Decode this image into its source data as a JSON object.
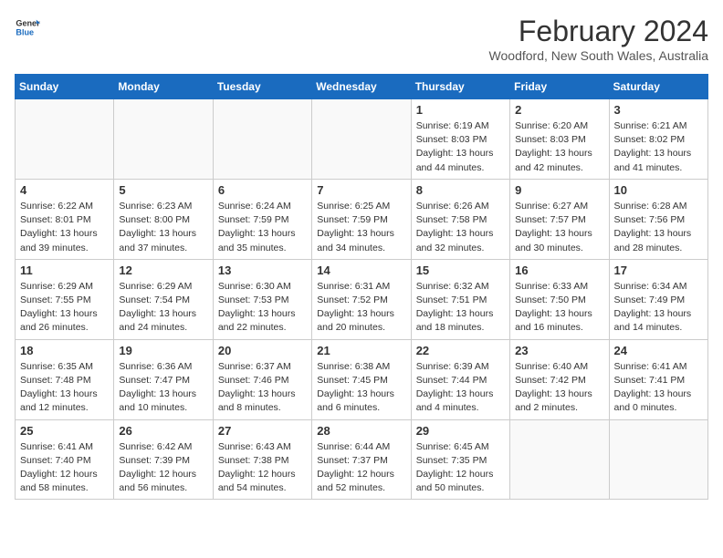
{
  "header": {
    "logo_text_general": "General",
    "logo_text_blue": "Blue",
    "month_year": "February 2024",
    "location": "Woodford, New South Wales, Australia"
  },
  "weekdays": [
    "Sunday",
    "Monday",
    "Tuesday",
    "Wednesday",
    "Thursday",
    "Friday",
    "Saturday"
  ],
  "weeks": [
    [
      {
        "day": "",
        "info": ""
      },
      {
        "day": "",
        "info": ""
      },
      {
        "day": "",
        "info": ""
      },
      {
        "day": "",
        "info": ""
      },
      {
        "day": "1",
        "info": "Sunrise: 6:19 AM\nSunset: 8:03 PM\nDaylight: 13 hours\nand 44 minutes."
      },
      {
        "day": "2",
        "info": "Sunrise: 6:20 AM\nSunset: 8:03 PM\nDaylight: 13 hours\nand 42 minutes."
      },
      {
        "day": "3",
        "info": "Sunrise: 6:21 AM\nSunset: 8:02 PM\nDaylight: 13 hours\nand 41 minutes."
      }
    ],
    [
      {
        "day": "4",
        "info": "Sunrise: 6:22 AM\nSunset: 8:01 PM\nDaylight: 13 hours\nand 39 minutes."
      },
      {
        "day": "5",
        "info": "Sunrise: 6:23 AM\nSunset: 8:00 PM\nDaylight: 13 hours\nand 37 minutes."
      },
      {
        "day": "6",
        "info": "Sunrise: 6:24 AM\nSunset: 7:59 PM\nDaylight: 13 hours\nand 35 minutes."
      },
      {
        "day": "7",
        "info": "Sunrise: 6:25 AM\nSunset: 7:59 PM\nDaylight: 13 hours\nand 34 minutes."
      },
      {
        "day": "8",
        "info": "Sunrise: 6:26 AM\nSunset: 7:58 PM\nDaylight: 13 hours\nand 32 minutes."
      },
      {
        "day": "9",
        "info": "Sunrise: 6:27 AM\nSunset: 7:57 PM\nDaylight: 13 hours\nand 30 minutes."
      },
      {
        "day": "10",
        "info": "Sunrise: 6:28 AM\nSunset: 7:56 PM\nDaylight: 13 hours\nand 28 minutes."
      }
    ],
    [
      {
        "day": "11",
        "info": "Sunrise: 6:29 AM\nSunset: 7:55 PM\nDaylight: 13 hours\nand 26 minutes."
      },
      {
        "day": "12",
        "info": "Sunrise: 6:29 AM\nSunset: 7:54 PM\nDaylight: 13 hours\nand 24 minutes."
      },
      {
        "day": "13",
        "info": "Sunrise: 6:30 AM\nSunset: 7:53 PM\nDaylight: 13 hours\nand 22 minutes."
      },
      {
        "day": "14",
        "info": "Sunrise: 6:31 AM\nSunset: 7:52 PM\nDaylight: 13 hours\nand 20 minutes."
      },
      {
        "day": "15",
        "info": "Sunrise: 6:32 AM\nSunset: 7:51 PM\nDaylight: 13 hours\nand 18 minutes."
      },
      {
        "day": "16",
        "info": "Sunrise: 6:33 AM\nSunset: 7:50 PM\nDaylight: 13 hours\nand 16 minutes."
      },
      {
        "day": "17",
        "info": "Sunrise: 6:34 AM\nSunset: 7:49 PM\nDaylight: 13 hours\nand 14 minutes."
      }
    ],
    [
      {
        "day": "18",
        "info": "Sunrise: 6:35 AM\nSunset: 7:48 PM\nDaylight: 13 hours\nand 12 minutes."
      },
      {
        "day": "19",
        "info": "Sunrise: 6:36 AM\nSunset: 7:47 PM\nDaylight: 13 hours\nand 10 minutes."
      },
      {
        "day": "20",
        "info": "Sunrise: 6:37 AM\nSunset: 7:46 PM\nDaylight: 13 hours\nand 8 minutes."
      },
      {
        "day": "21",
        "info": "Sunrise: 6:38 AM\nSunset: 7:45 PM\nDaylight: 13 hours\nand 6 minutes."
      },
      {
        "day": "22",
        "info": "Sunrise: 6:39 AM\nSunset: 7:44 PM\nDaylight: 13 hours\nand 4 minutes."
      },
      {
        "day": "23",
        "info": "Sunrise: 6:40 AM\nSunset: 7:42 PM\nDaylight: 13 hours\nand 2 minutes."
      },
      {
        "day": "24",
        "info": "Sunrise: 6:41 AM\nSunset: 7:41 PM\nDaylight: 13 hours\nand 0 minutes."
      }
    ],
    [
      {
        "day": "25",
        "info": "Sunrise: 6:41 AM\nSunset: 7:40 PM\nDaylight: 12 hours\nand 58 minutes."
      },
      {
        "day": "26",
        "info": "Sunrise: 6:42 AM\nSunset: 7:39 PM\nDaylight: 12 hours\nand 56 minutes."
      },
      {
        "day": "27",
        "info": "Sunrise: 6:43 AM\nSunset: 7:38 PM\nDaylight: 12 hours\nand 54 minutes."
      },
      {
        "day": "28",
        "info": "Sunrise: 6:44 AM\nSunset: 7:37 PM\nDaylight: 12 hours\nand 52 minutes."
      },
      {
        "day": "29",
        "info": "Sunrise: 6:45 AM\nSunset: 7:35 PM\nDaylight: 12 hours\nand 50 minutes."
      },
      {
        "day": "",
        "info": ""
      },
      {
        "day": "",
        "info": ""
      }
    ]
  ]
}
